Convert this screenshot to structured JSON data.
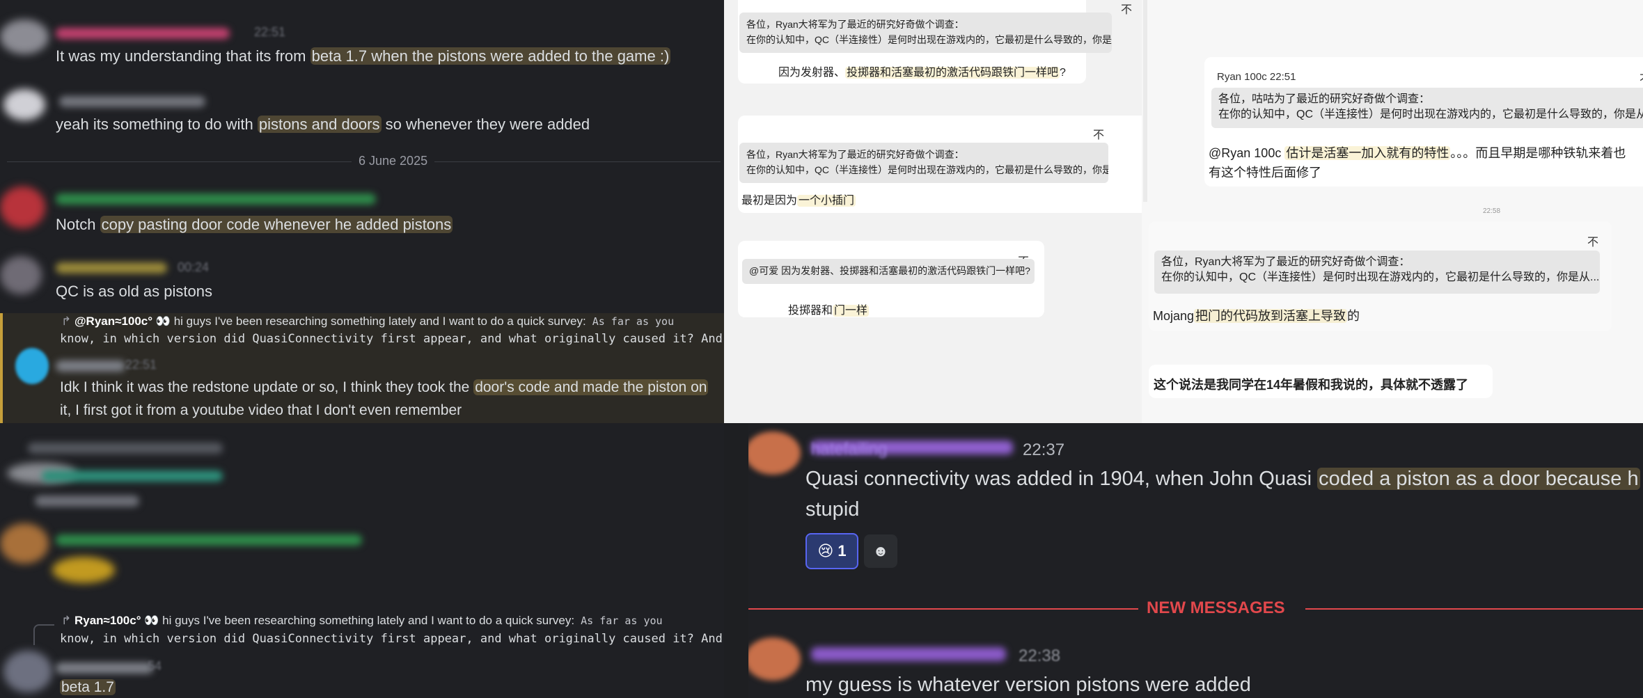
{
  "left": {
    "msg1": {
      "time": "22:51",
      "pre": "It was my understanding that its from ",
      "hl": "beta 1.7 when the pistons were added to the game :)"
    },
    "msg2": {
      "pre": "yeah its something to do with ",
      "hl": "pistons and doors",
      "post": " so whenever they were added"
    },
    "date_divider": "6 June 2025",
    "msg3": {
      "pre": "Notch ",
      "hl": "copy pasting door code whenever he added pistons"
    },
    "msg4": {
      "time": "00:24",
      "text": "QC is as old as pistons"
    },
    "reply1": {
      "author": "@Ryan≈100c°",
      "emoji": "👀",
      "lead": " hi guys I've been researching something lately and I want to do a quick survey:",
      "mono1": " As far as you",
      "mono2": "know, in which version did QuasiConnectivity first appear, and what originally caused it? And where",
      "time": "22:51",
      "line1_pre": "Idk I think it was the redstone update or so, I think they took the ",
      "line1_hl": "door's code and made the piston on",
      "line2": "it, I first got it from a youtube video that I don't even remember"
    },
    "reply2": {
      "author": "Ryan≈100c°",
      "emoji": "👀",
      "lead": " hi guys I've been researching something lately and I want to do a quick survey:",
      "mono1": " As far as you",
      "mono2": "know, in which version did QuasiConnectivity first appear, and what originally caused it? And where",
      "time": "54",
      "answer": "beta 1.7"
    }
  },
  "mid": {
    "q_line1": "各位，Ryan大将军为了最近的研究好奇做个调查：",
    "q_line2": "在你的认知中，QC（半连接性）是何时出现在游戏内的，它最初是什么导致的，你是从...",
    "card1_pre": "因为发射器、",
    "card1_hl": "投掷器和活塞最初的激活代码跟铁门一样吧",
    "card1_post": "?",
    "card2_pre": "最初是因为",
    "card2_hl": "一个小插门",
    "card3_quote": "@可爱 因为发射器、投掷器和活塞最初的激活代码跟铁门一样吧?",
    "card3_pre": "投掷器和",
    "card3_hl": "门一样",
    "pin": "不"
  },
  "mid2": {
    "card1_author": "Ryan 100c 22:51",
    "card1_q1": "各位，咕咕为了最近的研究好奇做个调查：",
    "card1_q2": "在你的认知中，QC（半连接性）是何时出现在游戏内的，它最初是什么导致的，你是从...",
    "card1_line1_pre": "@Ryan 100c ",
    "card1_line1_hl": "估计是活塞一加入就有的特性",
    "card1_line1_post": "。。。而且早期是哪种铁轨来着也",
    "card1_line2": "有这个特性后面修了",
    "timestamp": "22:58",
    "card2_q1": "各位，Ryan大将军为了最近的研究好奇做个调查：",
    "card2_q2": "在你的认知中，QC（半连接性）是何时出现在游戏内的，它最初是什么导致的，你是从...",
    "card2_pre": "Mojang",
    "card2_hl": "把门的代码放到活塞上导致",
    "card2_post": "的",
    "card3": "这个说法是我同学在14年暑假和我说的，具体就不透露了",
    "pin": "不"
  },
  "br": {
    "name1": "hatefailing",
    "time1": "22:37",
    "line1_pre": "Quasi connectivity was added in 1904, when John Quasi ",
    "line1_hl": "coded a piston as a door because h",
    "line2": "stupid",
    "reaction_emoji": "😢",
    "reaction_count": "1",
    "add_reaction_emoji": "☻",
    "new_messages": "NEW MESSAGES",
    "time2": "22:38",
    "line3": "my guess is whatever version pistons were added"
  },
  "colors": {
    "bg_dark": "#1f2024",
    "highlight": "#c8aa5a",
    "new_messages": "#e2484c",
    "reply_border": "#c69f3a"
  }
}
